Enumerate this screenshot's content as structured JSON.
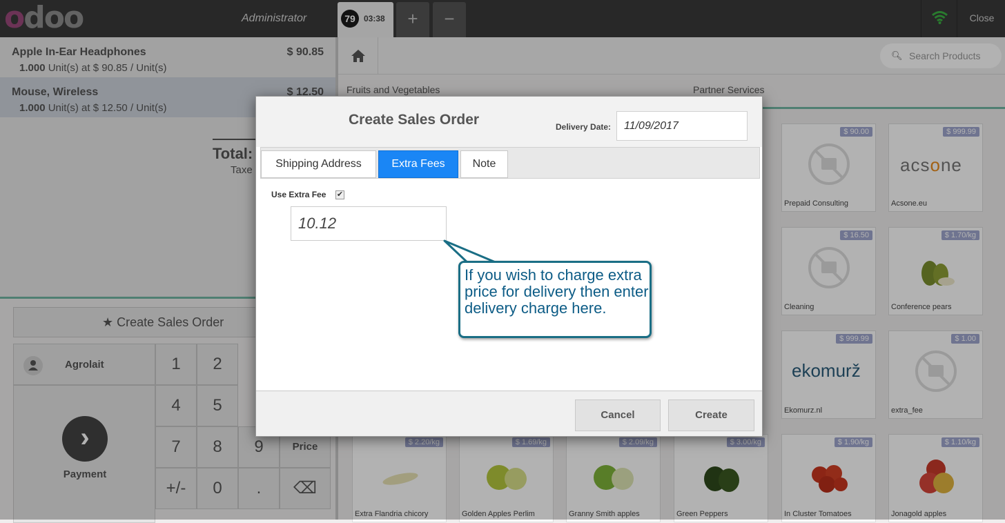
{
  "topbar": {
    "logo": "odoo",
    "user": "Administrator",
    "order_number": "79",
    "order_time": "03:38",
    "add_label": "+",
    "remove_label": "−",
    "close_label": "Close"
  },
  "order": {
    "lines": [
      {
        "name": "Apple In-Ear Headphones",
        "price": "$ 90.85",
        "qty": "1.000",
        "unit_info": "Unit(s) at $ 90.85 / Unit(s)"
      },
      {
        "name": "Mouse, Wireless",
        "price": "$ 12.50",
        "qty": "1.000",
        "unit_info": "Unit(s) at $ 12.50 / Unit(s)"
      }
    ],
    "total_label": "Total:",
    "taxes_label": "Taxe"
  },
  "actions": {
    "create_sales_order": "Create Sales Order",
    "customer": "Agrolait",
    "payment": "Payment",
    "keys": [
      "1",
      "2",
      "4",
      "5",
      "7",
      "8",
      "9",
      "Price",
      "+/-",
      "0",
      ".",
      "⌫"
    ]
  },
  "products": {
    "search_placeholder": "Search Products",
    "categories": [
      "Fruits and Vegetables",
      "Partner Services"
    ],
    "items": [
      {
        "name": "Prepaid Consulting",
        "price": "$ 90.00"
      },
      {
        "name": "Acsone.eu",
        "price": "$ 999.99"
      },
      {
        "name": "Cleaning",
        "price": "$ 16.50"
      },
      {
        "name": "Conference pears",
        "price": "$ 1.70/kg"
      },
      {
        "name": "Ekomurz.nl",
        "price": "$ 999.99"
      },
      {
        "name": "extra_fee",
        "price": "$ 1.00"
      },
      {
        "name": "Extra Flandria chicory",
        "price": "$ 2.20/kg"
      },
      {
        "name": "Golden Apples Perlim",
        "price": "$ 1.69/kg"
      },
      {
        "name": "Granny Smith apples",
        "price": "$ 2.09/kg"
      },
      {
        "name": "Green Peppers",
        "price": "$ 3.00/kg"
      },
      {
        "name": "In Cluster Tomatoes",
        "price": "$ 1.90/kg"
      },
      {
        "name": "Jonagold apples",
        "price": "$ 1.10/kg"
      }
    ],
    "logo_texts": {
      "acsone": "acsone",
      "ekomurz": "ekomurž"
    }
  },
  "modal": {
    "title": "Create Sales Order",
    "delivery_date_label": "Delivery Date:",
    "delivery_date_value": "11/09/2017",
    "tabs": [
      "Shipping Address",
      "Extra Fees",
      "Note"
    ],
    "active_tab": "Extra Fees",
    "use_extra_fee_label": "Use Extra Fee",
    "use_extra_fee_checked": true,
    "extra_fee_value": "10.12",
    "cancel_label": "Cancel",
    "create_label": "Create"
  },
  "callout": {
    "text": "If you wish to charge extra price for delivery then enter delivery charge here."
  },
  "colors": {
    "topbar": "#3a3a3a",
    "accent_green": "#71b7a4",
    "active_tab": "#1a86f5",
    "callout_border": "#1a6e85",
    "callout_text": "#0d5c86",
    "price_tag": "#9fa6ce",
    "logo_purple": "#9b4a7b"
  }
}
